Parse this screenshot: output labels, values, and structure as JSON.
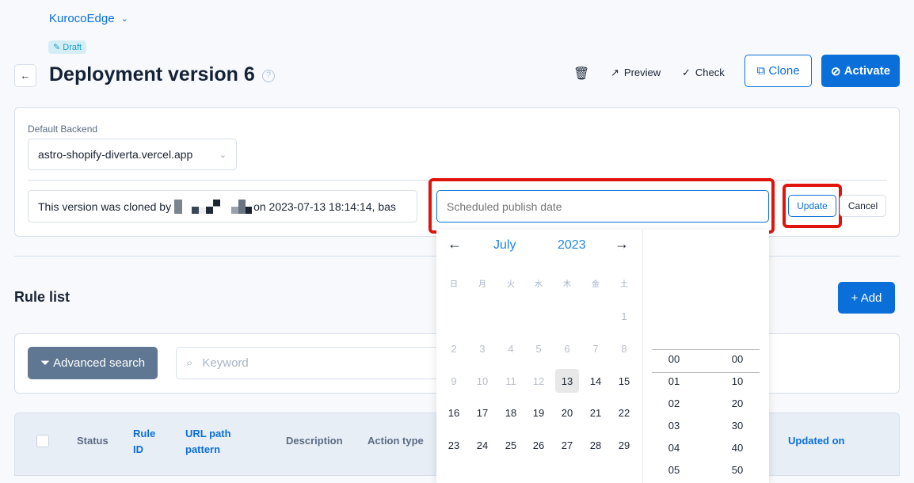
{
  "header": {
    "project": "KurocoEdge",
    "status_badge": "Draft",
    "title": "Deployment version 6"
  },
  "toolbar": {
    "preview": "Preview",
    "check": "Check",
    "clone": "Clone",
    "activate": "Activate"
  },
  "settings": {
    "backend_label": "Default Backend",
    "backend_value": "astro-shopify-diverta.vercel.app",
    "note": "This version was cloned by",
    "note_suffix": "on 2023-07-13 18:14:14, bas",
    "schedule_placeholder": "Scheduled publish date",
    "update": "Update",
    "cancel": "Cancel"
  },
  "calendar": {
    "month": "July",
    "year": "2023",
    "weekdays": [
      "日",
      "月",
      "火",
      "水",
      "木",
      "金",
      "土"
    ],
    "weeks": [
      [
        "",
        "",
        "",
        "",
        "",
        "",
        "1"
      ],
      [
        "2",
        "3",
        "4",
        "5",
        "6",
        "7",
        "8"
      ],
      [
        "9",
        "10",
        "11",
        "12",
        "13",
        "14",
        "15"
      ],
      [
        "16",
        "17",
        "18",
        "19",
        "20",
        "21",
        "22"
      ],
      [
        "23",
        "24",
        "25",
        "26",
        "27",
        "28",
        "29"
      ]
    ],
    "selected": "13",
    "disabled_before": "13",
    "hours": [
      "00",
      "01",
      "02",
      "03",
      "04",
      "05"
    ],
    "minutes": [
      "00",
      "10",
      "20",
      "30",
      "40",
      "50"
    ]
  },
  "rules": {
    "title": "Rule list",
    "add": "+ Add",
    "advanced_search": "Advanced search",
    "keyword_placeholder": "Keyword",
    "columns": {
      "status": "Status",
      "rule_id": "Rule ID",
      "url_path": "URL path pattern",
      "description": "Description",
      "action_type": "Action type",
      "updated_on": "Updated on"
    }
  },
  "colors": {
    "primary": "#0a6fd8",
    "highlight": "#e0140c",
    "badge_bg": "#d5eef6",
    "advanced_btn": "#5f7792"
  }
}
